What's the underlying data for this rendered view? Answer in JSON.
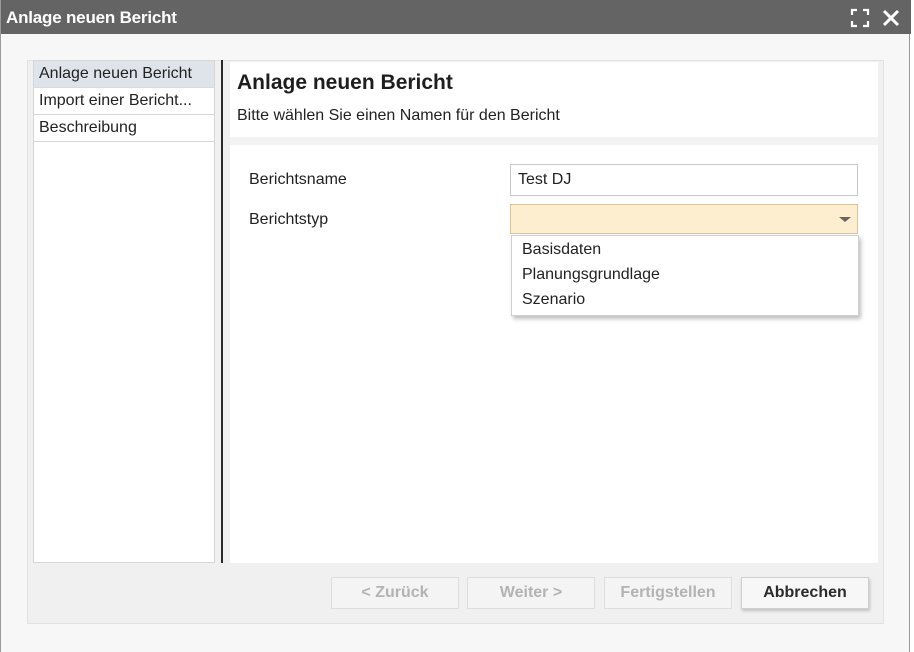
{
  "window": {
    "title": "Anlage neuen Bericht",
    "maximize_icon": "maximize-icon",
    "close_icon": "close-icon"
  },
  "sidebar": {
    "items": [
      {
        "label": "Anlage neuen Bericht",
        "active": true
      },
      {
        "label": "Import einer Bericht...",
        "active": false
      },
      {
        "label": "Beschreibung",
        "active": false
      }
    ]
  },
  "content": {
    "heading": "Anlage neuen Bericht",
    "subheading": "Bitte wählen Sie einen Namen für den Bericht"
  },
  "form": {
    "name_label": "Berichtsname",
    "name_value": "Test DJ",
    "type_label": "Berichtstyp",
    "type_value": "",
    "type_options": [
      "Basisdaten",
      "Planungsgrundlage",
      "Szenario"
    ]
  },
  "footer": {
    "back_label": "< Zurück",
    "next_label": "Weiter >",
    "finish_label": "Fertigstellen",
    "cancel_label": "Abbrechen"
  },
  "colors": {
    "titlebar": "#646464",
    "select_highlight": "#fdeecf",
    "nav_active": "#dfe4ea"
  }
}
